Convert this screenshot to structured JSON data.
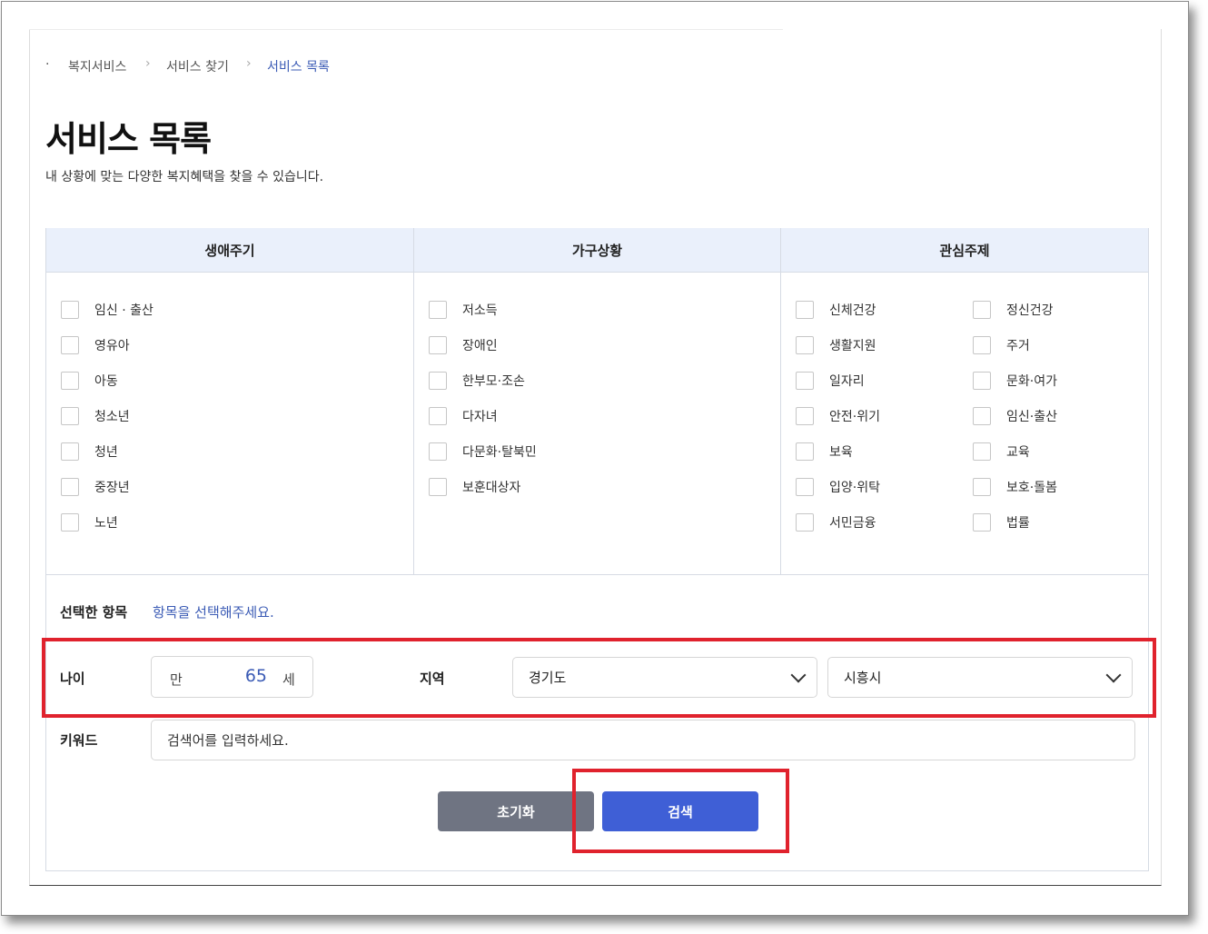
{
  "breadcrumb": {
    "bullet": "·",
    "separator": "›",
    "items": [
      "복지서비스",
      "서비스 찾기",
      "서비스 목록"
    ]
  },
  "page": {
    "title": "서비스 목록",
    "subtitle": "내 상황에 맞는 다양한 복지혜택을 찾을 수 있습니다."
  },
  "filters": {
    "columns": [
      "생애주기",
      "가구상황",
      "관심주제"
    ],
    "life_cycle": [
      "임신 · 출산",
      "영유아",
      "아동",
      "청소년",
      "청년",
      "중장년",
      "노년"
    ],
    "household": [
      "저소득",
      "장애인",
      "한부모·조손",
      "다자녀",
      "다문화·탈북민",
      "보훈대상자"
    ],
    "interest_left": [
      "신체건강",
      "생활지원",
      "일자리",
      "안전·위기",
      "보육",
      "입양·위탁",
      "서민금융"
    ],
    "interest_right": [
      "정신건강",
      "주거",
      "문화·여가",
      "임신·출산",
      "교육",
      "보호·돌봄",
      "법률"
    ]
  },
  "selected": {
    "label": "선택한 항목",
    "placeholder": "항목을 선택해주세요."
  },
  "age": {
    "label": "나이",
    "prefix": "만",
    "value": "65",
    "suffix": "세"
  },
  "region": {
    "label": "지역",
    "province": "경기도",
    "city": "시흥시"
  },
  "keyword": {
    "label": "키워드",
    "placeholder": "검색어를 입력하세요."
  },
  "buttons": {
    "reset": "초기화",
    "search": "검색"
  },
  "colors": {
    "header_bg": "#eaf0fb",
    "accent": "#3b5bb5",
    "search_button": "#3f5fd6",
    "reset_button": "#6f7482",
    "highlight": "#e0222d"
  }
}
